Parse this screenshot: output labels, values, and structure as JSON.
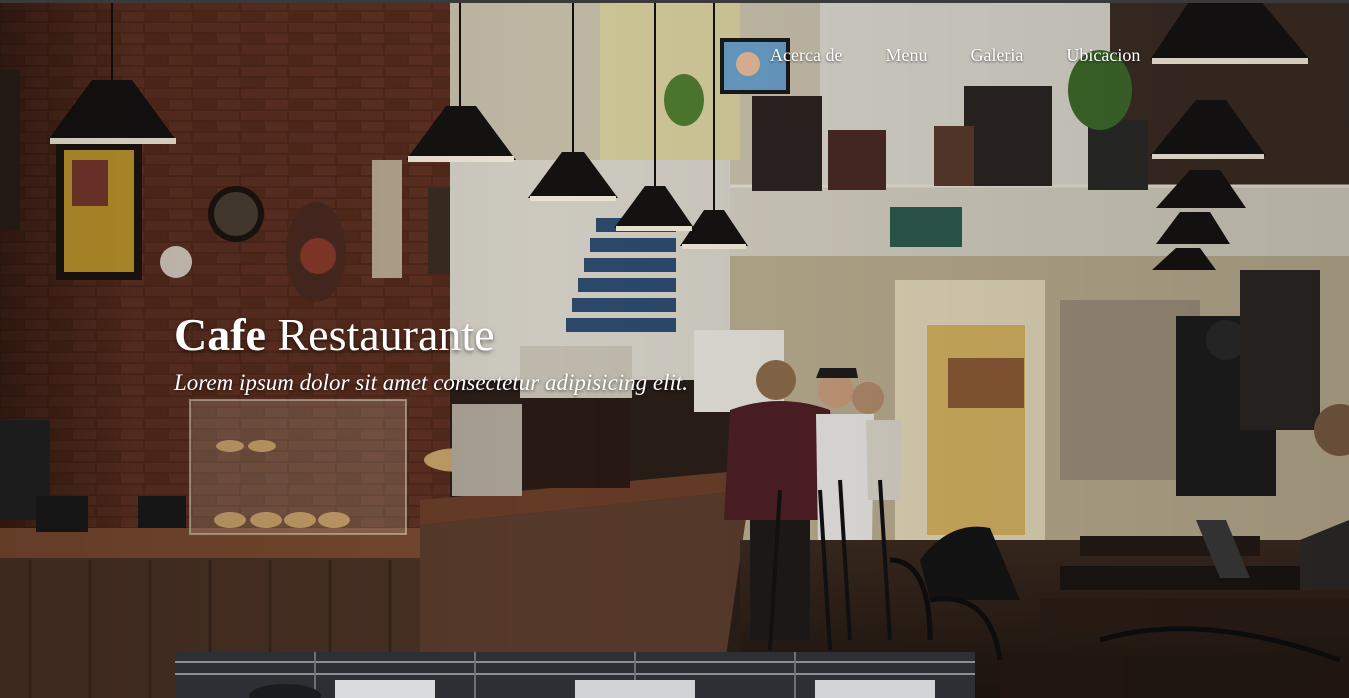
{
  "nav": {
    "items": [
      {
        "label": "Acerca de"
      },
      {
        "label": "Menu"
      },
      {
        "label": "Galeria"
      },
      {
        "label": "Ubicacion"
      }
    ]
  },
  "hero": {
    "title_bold": "Cafe",
    "title_rest": " Restaurante",
    "subtitle": "Lorem ipsum dolor sit amet consectetur adipisicing elit."
  },
  "colors": {
    "text": "#ffffff",
    "brick": "#5a2e20",
    "wood": "#4a3326",
    "wall": "#d9d3c2"
  }
}
